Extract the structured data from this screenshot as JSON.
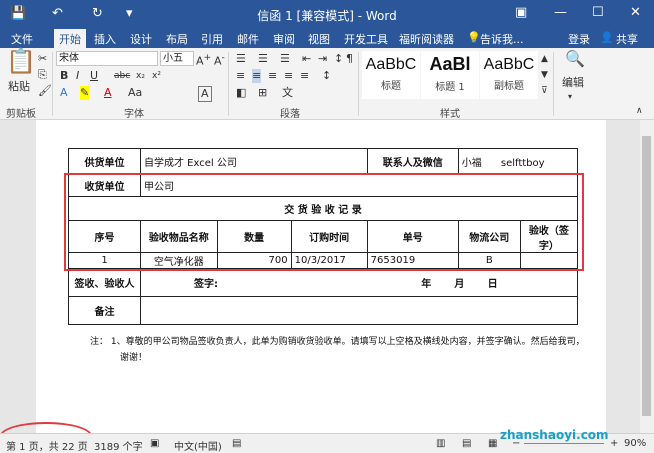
{
  "titlebar": {
    "title": "信函 1 [兼容模式] - Word",
    "save_icon": "💾",
    "undo": "↶",
    "redo": "↻",
    "customize": "▾"
  },
  "tabs": [
    "文件",
    "开始",
    "插入",
    "设计",
    "布局",
    "引用",
    "邮件",
    "审阅",
    "视图",
    "开发工具",
    "福昕阅读器"
  ],
  "tell_me": "告诉我...",
  "sign_in": "登录",
  "share": "共享",
  "ribbon": {
    "paste": "粘贴",
    "clipboard": "剪贴板",
    "font_name": "宋体",
    "font_size": "小五",
    "font_group": "字体",
    "paragraph_group": "段落",
    "styles_group": "样式",
    "edit": "编辑",
    "styles": [
      {
        "sample": "AaBbC",
        "name": "标题"
      },
      {
        "sample": "AaBl",
        "name": "标题 1"
      },
      {
        "sample": "AaBbC",
        "name": "副标题"
      }
    ]
  },
  "doc": {
    "supplier_label": "供货单位",
    "supplier_value": "自学成才 Excel 公司",
    "contact_label": "联系人及微信",
    "contact_name": "小福",
    "contact_wechat": "selfttboy",
    "receiver_label": "收货单位",
    "receiver_value": "甲公司",
    "record_title": "交 货 验 收 记 录",
    "headers": [
      "序号",
      "验收物品名称",
      "数量",
      "订购时间",
      "单号",
      "物流公司",
      "验收（签字）"
    ],
    "row": [
      "1",
      "空气净化器",
      "700",
      "10/3/2017",
      "7653019",
      "B",
      ""
    ],
    "sign_label": "签收、验收人",
    "sign_text": "签字:",
    "date_year": "年",
    "date_month": "月",
    "date_day": "日",
    "remark_label": "备注",
    "note_prefix": "注：",
    "note_1": "1、尊敬的甲公司物品签收负责人，此单为购销收货验收单。请填写以上空格及横线处内容，并签字确认。然后给我司，",
    "note_2": "谢谢！"
  },
  "status": {
    "page": "第 1 页，共 22 页",
    "words": "3189 个字",
    "lang": "中文(中国)",
    "zoom": "90%"
  },
  "watermark": "zhanshaoyi.com"
}
